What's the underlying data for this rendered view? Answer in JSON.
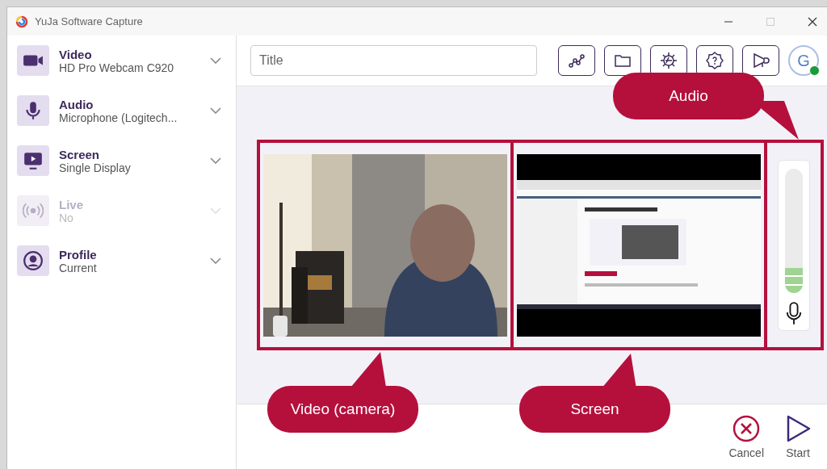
{
  "window": {
    "title": "YuJa Software Capture"
  },
  "sources": [
    {
      "kind": "video",
      "label": "Video",
      "value": "HD Pro Webcam C920",
      "disabled": false
    },
    {
      "kind": "audio",
      "label": "Audio",
      "value": "Microphone (Logitech...",
      "disabled": false
    },
    {
      "kind": "screen",
      "label": "Screen",
      "value": "Single Display",
      "disabled": false
    },
    {
      "kind": "live",
      "label": "Live",
      "value": "No",
      "disabled": true
    },
    {
      "kind": "profile",
      "label": "Profile",
      "value": "Current",
      "disabled": false
    }
  ],
  "title_field": {
    "placeholder": "Title"
  },
  "toolbar": [
    {
      "kind": "graph"
    },
    {
      "kind": "folder"
    },
    {
      "kind": "settings"
    },
    {
      "kind": "help"
    },
    {
      "kind": "announce"
    }
  ],
  "avatar": {
    "initial": "G",
    "online": true
  },
  "audio_meter": {
    "level": 0.2
  },
  "callouts": [
    {
      "kind": "audio",
      "text": "Audio"
    },
    {
      "kind": "video",
      "text": "Video (camera)"
    },
    {
      "kind": "screen",
      "text": "Screen"
    }
  ],
  "actions": [
    {
      "kind": "cancel",
      "label": "Cancel"
    },
    {
      "kind": "start",
      "label": "Start"
    }
  ]
}
